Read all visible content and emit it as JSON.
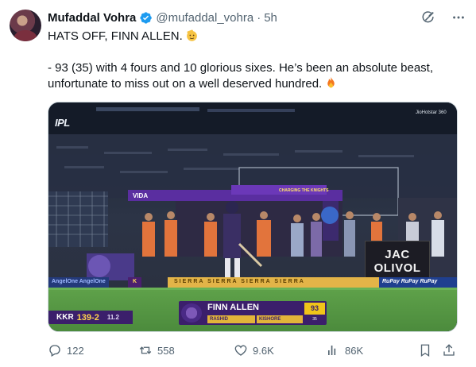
{
  "author": {
    "name": "Mufaddal Vohra",
    "handle": "@mufaddal_vohra",
    "separator": "·",
    "time": "5h"
  },
  "tweet": {
    "line1": "HATS OFF, FINN ALLEN.",
    "line2": "- 93 (35) with 4 fours and 10 glorious sixes. He’s been an absolute beast, unfortunate to miss out on a well deserved hundred."
  },
  "media": {
    "broadcaster_caption": "JioHotstar 360",
    "league_logo": "IPL",
    "stand_label": "VIDA",
    "charge_label": "CHARGING THE KNIGHTS",
    "board_text": "JAC OLIVOL",
    "ads": {
      "left": "AngelOne  AngelOne",
      "mid": "K",
      "sierra": "SIERRA   SIERRA   SIERRA   SIERRA",
      "rupay": "RuPay  RuPay  RuPay"
    },
    "scoreboard": {
      "team": "KKR",
      "runs": "139-2",
      "overs": "11.2"
    },
    "batter": {
      "name": "FINN ALLEN",
      "score": "93",
      "balls": "35",
      "partner_a": "RASHID",
      "partner_b": "KISHORE"
    }
  },
  "actions": {
    "replies": "122",
    "retweets": "558",
    "likes": "9.6K",
    "views": "86K"
  },
  "colors": {
    "text": "#0f1419",
    "secondary": "#536471",
    "verified": "#1d9bf0",
    "kkr_purple": "#3b1f6b",
    "kkr_gold": "#f0c419"
  },
  "icons": {
    "verified": "verified-badge-icon",
    "grok": "grok-icon",
    "more": "more-dots-icon",
    "reply": "reply-icon",
    "retweet": "retweet-icon",
    "like": "heart-icon",
    "views": "views-icon",
    "bookmark": "bookmark-icon",
    "share": "share-icon"
  }
}
